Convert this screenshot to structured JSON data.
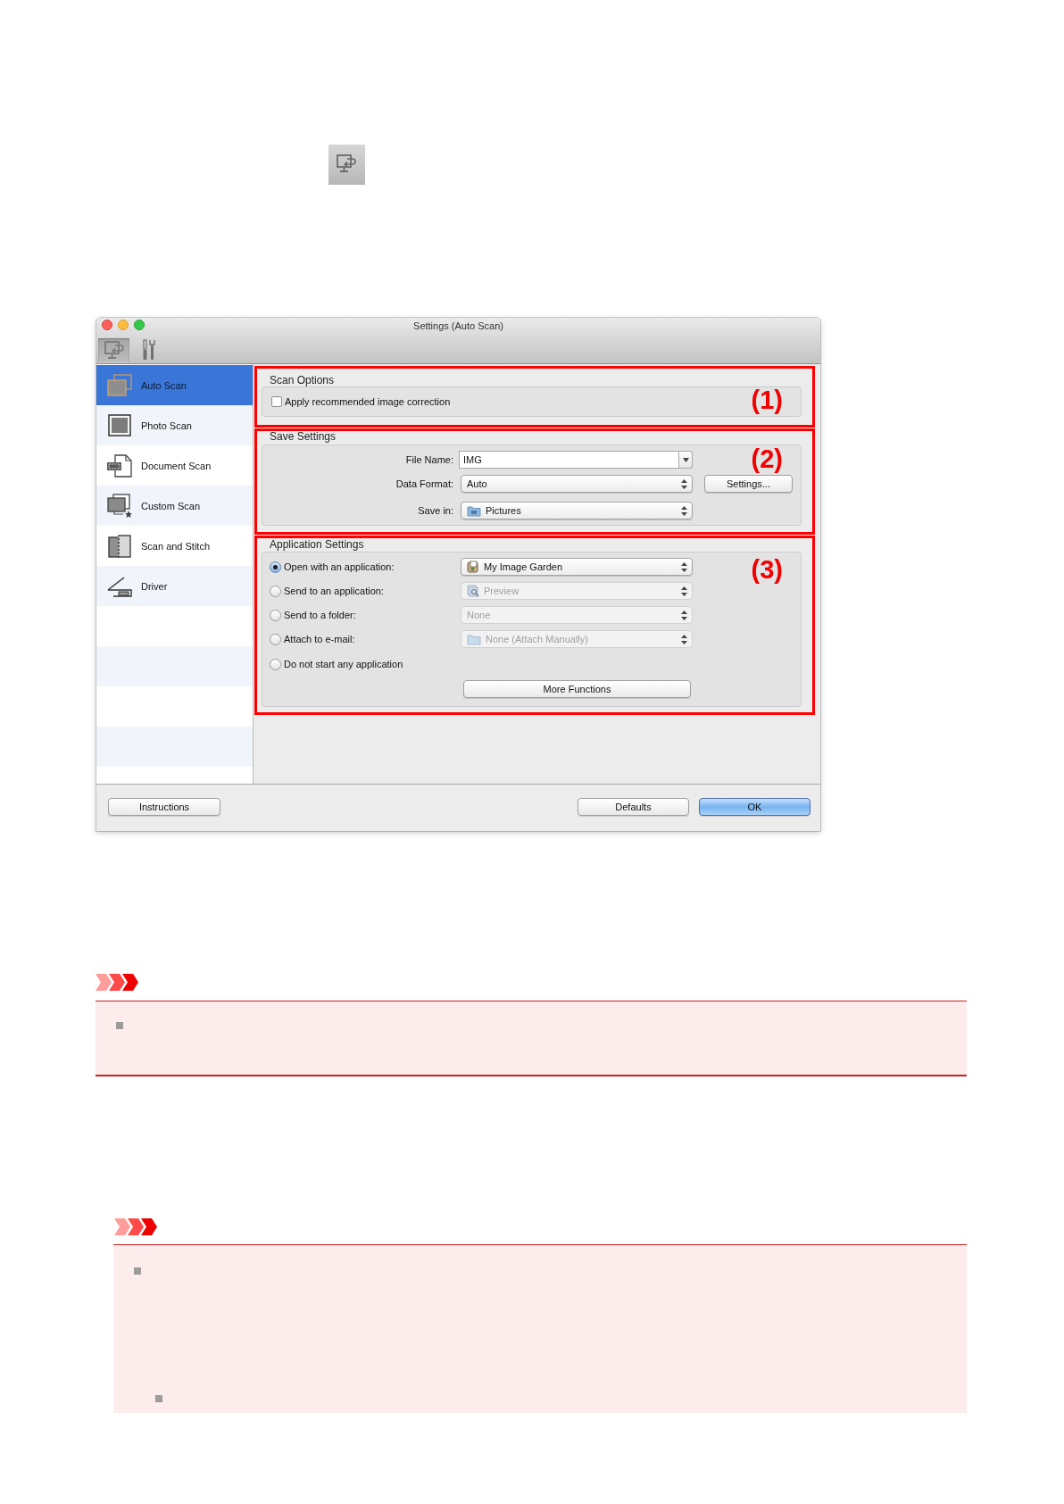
{
  "window": {
    "title": "Settings (Auto Scan)"
  },
  "toolbar": [
    {
      "selected": true
    },
    {
      "selected": false
    }
  ],
  "sidebar": {
    "items": [
      {
        "label": "Auto Scan",
        "selected": true
      },
      {
        "label": "Photo Scan",
        "selected": false
      },
      {
        "label": "Document Scan",
        "selected": false
      },
      {
        "label": "Custom Scan",
        "selected": false
      },
      {
        "label": "Scan and Stitch",
        "selected": false
      },
      {
        "label": "Driver",
        "selected": false
      }
    ]
  },
  "scan_options": {
    "title": "Scan Options",
    "callout": "(1)",
    "checkbox": {
      "label": "Apply recommended image correction",
      "checked": false
    }
  },
  "save_settings": {
    "title": "Save Settings",
    "callout": "(2)",
    "fields": [
      {
        "kind": "combo",
        "label": "File Name:",
        "value": "IMG"
      },
      {
        "kind": "popup",
        "label": "Data Format:",
        "value": "Auto",
        "button": "Settings..."
      },
      {
        "kind": "popup",
        "label": "Save in:",
        "value": "Pictures"
      }
    ]
  },
  "application_settings": {
    "title": "Application Settings",
    "callout": "(3)",
    "options": [
      {
        "label": "Open with an application:",
        "selected": true,
        "popup": {
          "value": "My Image Garden",
          "disabled": false
        }
      },
      {
        "label": "Send to an application:",
        "selected": false,
        "popup": {
          "value": "Preview",
          "disabled": true
        }
      },
      {
        "label": "Send to a folder:",
        "selected": false,
        "popup": {
          "value": "None",
          "disabled": true
        }
      },
      {
        "label": "Attach to e-mail:",
        "selected": false,
        "popup": {
          "value": "None (Attach Manually)",
          "disabled": true
        }
      },
      {
        "label": "Do not start any application",
        "selected": false
      }
    ],
    "button": "More Functions"
  },
  "footer": {
    "left_buttons": [
      {
        "label": "Instructions",
        "default": false
      }
    ],
    "right_buttons": [
      {
        "label": "Defaults",
        "default": false
      },
      {
        "label": "OK",
        "default": true
      }
    ]
  }
}
